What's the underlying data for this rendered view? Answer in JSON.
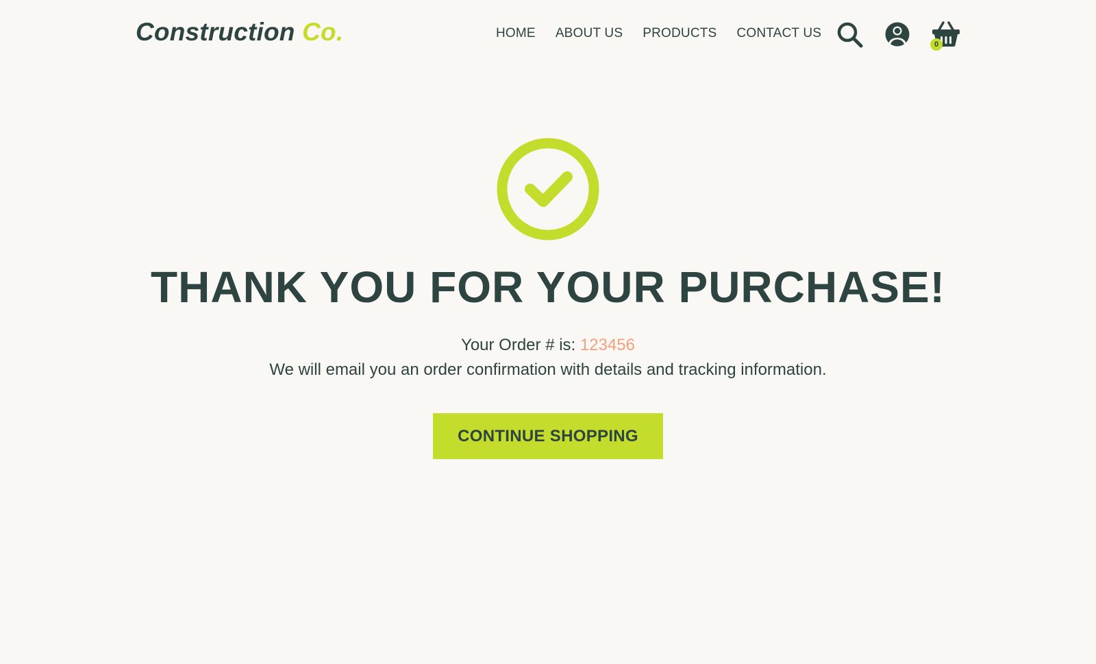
{
  "brand": {
    "name": "Construction",
    "suffix": "Co."
  },
  "nav": {
    "items": [
      "HOME",
      "ABOUT US",
      "PRODUCTS",
      "CONTACT US"
    ]
  },
  "cart": {
    "count": "0"
  },
  "icons": {
    "search": "search-icon",
    "account": "user-circle-icon",
    "cart": "basket-icon",
    "success": "check-circle-icon"
  },
  "confirmation": {
    "title": "THANK YOU FOR YOUR PURCHASE!",
    "order_label": "Your Order # is:",
    "order_number": "123456",
    "message": "We will email you an order confirmation with details and tracking information.",
    "button_label": "CONTINUE SHOPPING"
  },
  "colors": {
    "primary": "#2d4440",
    "accent": "#c4dc2c",
    "order_number": "#f4a07c",
    "background": "#faf8f5"
  }
}
